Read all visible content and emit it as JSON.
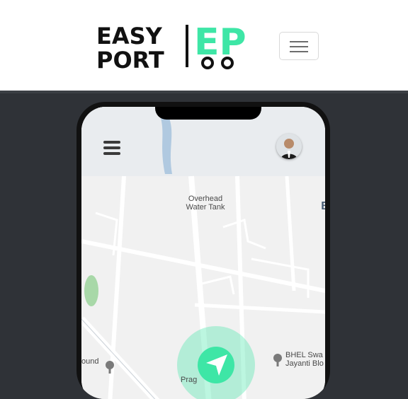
{
  "brand": {
    "line1": "EASY",
    "line2": "PORT",
    "mark": "EP",
    "colors": {
      "text": "#111111",
      "accent": "#3ee6a6",
      "wheels": "#111111"
    }
  },
  "navbar": {
    "toggle_icon": "hamburger-menu-icon",
    "background": "#ffffff"
  },
  "hero": {
    "background": "#2f3237",
    "phone": {
      "map_labels": {
        "overhead": "Overhead\nWater Tank",
        "b_label": "B",
        "bhel": "BHEL Swa\nJayanti Blo",
        "ound": "ound",
        "prag": "Prag"
      },
      "icons": {
        "menu": "menu-icon",
        "avatar": "avatar",
        "navigate": "navigation-arrow-icon",
        "pin": "map-pin-icon"
      },
      "accent": "#3ee6a6"
    }
  }
}
